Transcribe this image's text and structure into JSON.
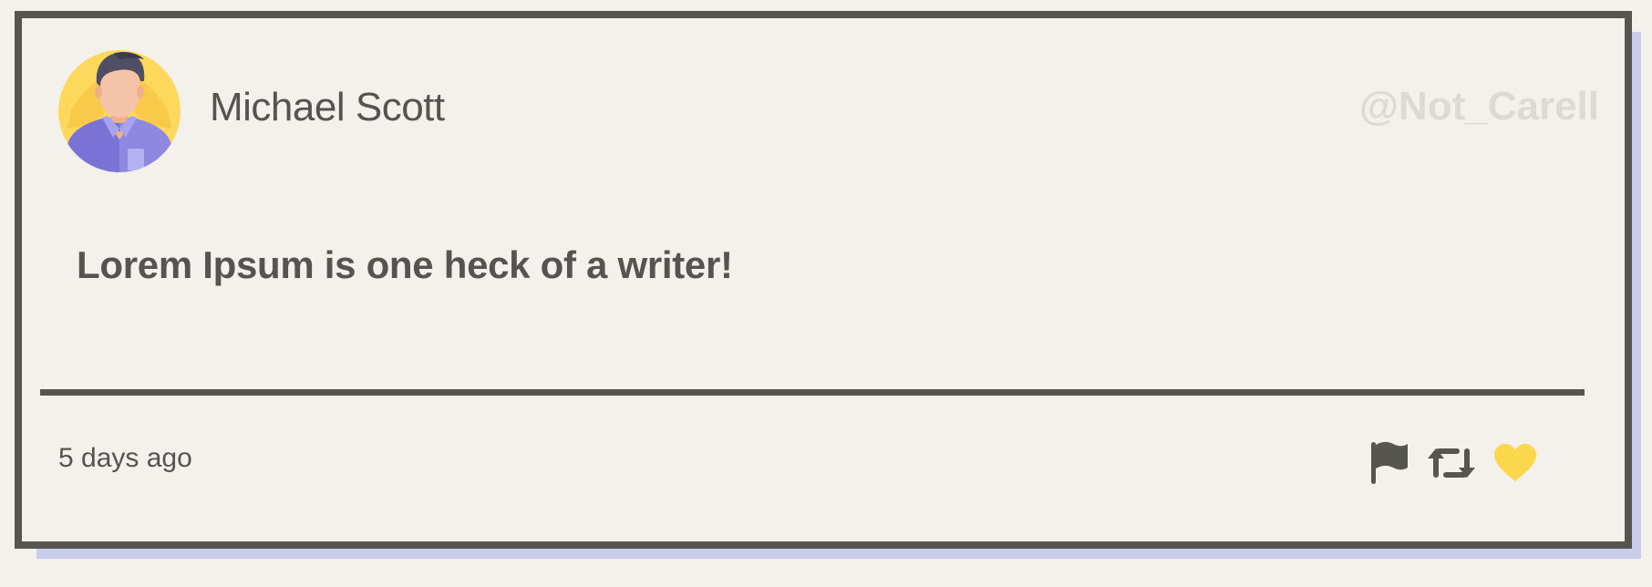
{
  "post": {
    "author_name": "Michael Scott",
    "author_handle": "@Not_Carell",
    "message": "Lorem Ipsum is one heck of a writer!",
    "timestamp": "5 days ago"
  },
  "actions": [
    {
      "name": "flag",
      "icon": "flag-icon"
    },
    {
      "name": "retweet",
      "icon": "retweet-icon"
    },
    {
      "name": "like",
      "icon": "heart-icon"
    }
  ],
  "colors": {
    "background": "#f4f1ec",
    "border": "#565550",
    "shadow": "#c8cdec",
    "text": "#555451",
    "handle": "#dcdad5",
    "heart": "#fbd84b",
    "avatar_bg": "#fdd85b",
    "shirt": "#8e88e0"
  }
}
